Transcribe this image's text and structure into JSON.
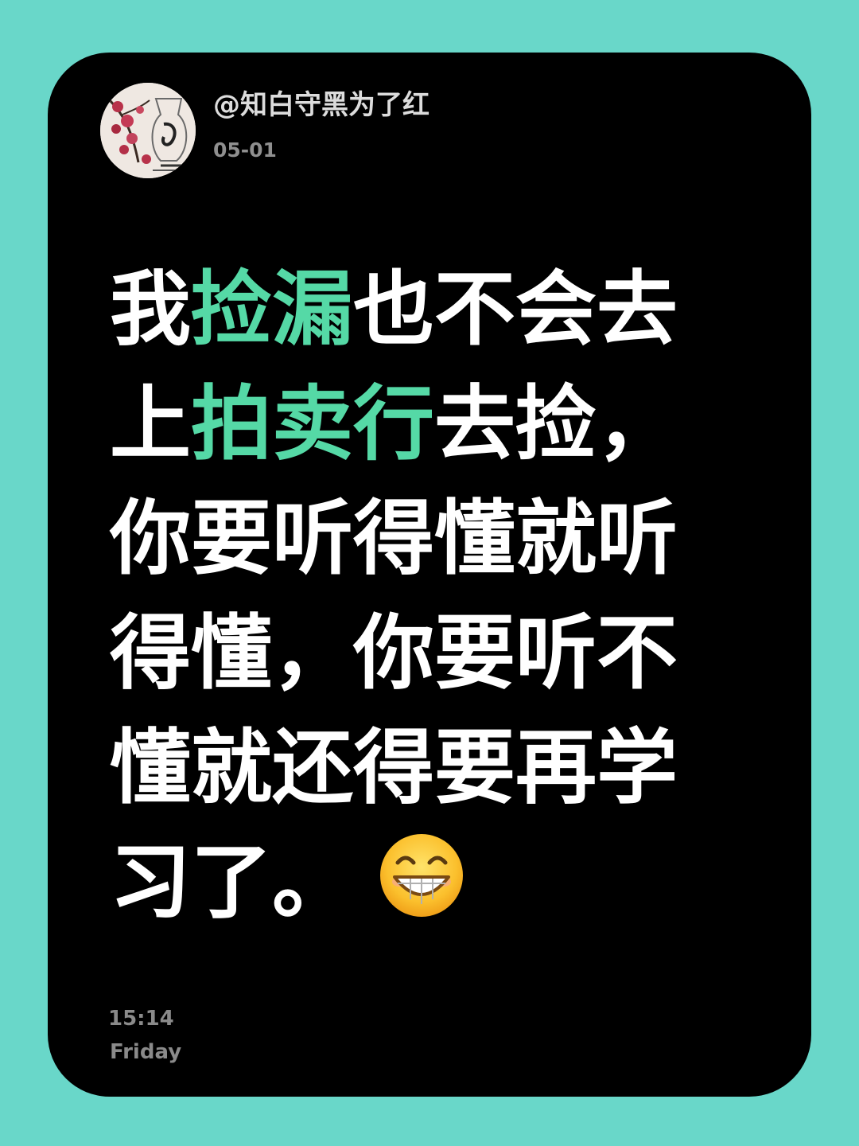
{
  "theme": {
    "background": "#69d7c9",
    "card": "#000000",
    "highlight": "#55d9a6",
    "text": "#ffffff"
  },
  "header": {
    "username": "@知白守黑为了红",
    "date": "05-01",
    "avatar_icon": "plum-blossom-painting-avatar"
  },
  "post": {
    "lines": [
      [
        {
          "text": "我",
          "hl": false
        },
        {
          "text": "捡漏",
          "hl": true
        },
        {
          "text": "也不会去",
          "hl": false
        }
      ],
      [
        {
          "text": "上",
          "hl": false
        },
        {
          "text": "拍卖行",
          "hl": true
        },
        {
          "text": "去捡，",
          "hl": false
        }
      ],
      [
        {
          "text": "你要听得懂就听",
          "hl": false
        }
      ],
      [
        {
          "text": "得懂，你要听不",
          "hl": false
        }
      ],
      [
        {
          "text": "懂就还得要再学",
          "hl": false
        }
      ],
      [
        {
          "text": "习了。",
          "hl": false
        }
      ]
    ],
    "emoji": "grinning-face-icon"
  },
  "footer": {
    "time": "15:14",
    "day": "Friday"
  }
}
